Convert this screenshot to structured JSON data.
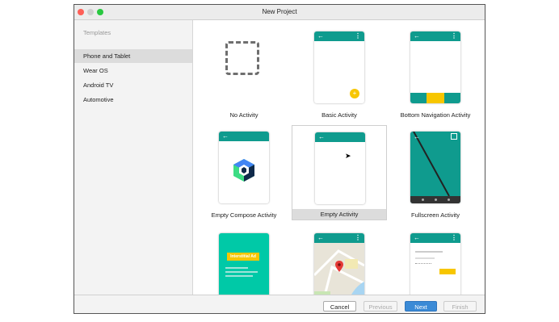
{
  "window": {
    "title": "New Project"
  },
  "sidebar": {
    "heading": "Templates",
    "items": [
      {
        "label": "Phone and Tablet",
        "selected": true
      },
      {
        "label": "Wear OS",
        "selected": false
      },
      {
        "label": "Android TV",
        "selected": false
      },
      {
        "label": "Automotive",
        "selected": false
      }
    ]
  },
  "templates": [
    {
      "label": "No Activity"
    },
    {
      "label": "Basic Activity"
    },
    {
      "label": "Bottom Navigation Activity"
    },
    {
      "label": "Empty Compose Activity"
    },
    {
      "label": "Empty Activity",
      "selected": true
    },
    {
      "label": "Fullscreen Activity"
    },
    {
      "label": ""
    },
    {
      "label": ""
    },
    {
      "label": ""
    }
  ],
  "ad_template": {
    "badge": "Interstitial Ad"
  },
  "footer": {
    "cancel_label": "Cancel",
    "previous_label": "Previous",
    "next_label": "Next",
    "finish_label": "Finish"
  },
  "colors": {
    "teal": "#0f9b8e",
    "accent": "#f7c600",
    "primary_button": "#3a8ad6"
  }
}
